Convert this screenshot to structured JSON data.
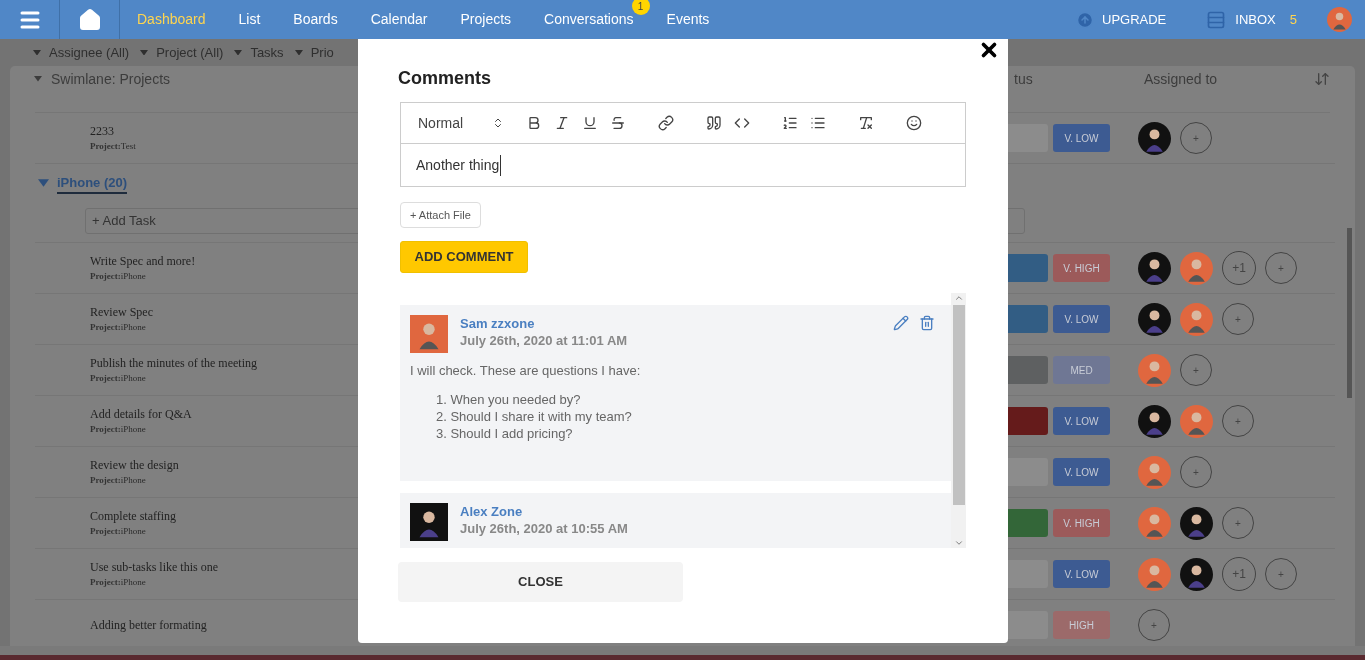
{
  "nav": {
    "items": [
      {
        "label": "Dashboard",
        "selected": true
      },
      {
        "label": "List",
        "selected": false
      },
      {
        "label": "Boards",
        "selected": false
      },
      {
        "label": "Calendar",
        "selected": false
      },
      {
        "label": "Projects",
        "selected": false
      },
      {
        "label": "Conversations",
        "selected": false,
        "badge": "1"
      },
      {
        "label": "Events",
        "selected": false
      }
    ],
    "upgrade": "UPGRADE",
    "inbox": "INBOX",
    "inbox_count": "5"
  },
  "filters": [
    "Assignee (All)",
    "Project (All)",
    "Tasks",
    "Prio"
  ],
  "swimlane": {
    "title": "Swimlane: Projects",
    "columns": [
      "tus",
      "Assigned to"
    ]
  },
  "rows_before": [
    {
      "name": "2233",
      "project_label": "Project:",
      "project": "Test",
      "status": {
        "color": "#8c8c8c"
      },
      "priority": {
        "label": "V. LOW",
        "color": "#3d5b92"
      },
      "assignees": [
        {
          "kind": "photo"
        }
      ],
      "add": "+"
    }
  ],
  "group": {
    "title": "iPhone (20)",
    "expanded": true,
    "add_task": "+ Add Task",
    "rows": [
      {
        "name": "Write Spec and more!",
        "project_label": "Project:",
        "project": "iPhone",
        "status": {
          "color": "#325d84"
        },
        "priority": {
          "label": "V. HIGH",
          "color": "#9c5a5a"
        },
        "assignees": [
          {
            "kind": "photo"
          },
          {
            "kind": "cartoon"
          }
        ],
        "extra": "+1",
        "add": "+"
      },
      {
        "name": "Review Spec",
        "project_label": "Project:",
        "project": "iPhone",
        "status": {
          "color": "#325d84"
        },
        "priority": {
          "label": "V. LOW",
          "color": "#3d5b92"
        },
        "assignees": [
          {
            "kind": "photo"
          },
          {
            "kind": "cartoon"
          }
        ],
        "add": "+"
      },
      {
        "name": "Publish the minutes of the meeting",
        "project_label": "Project:",
        "project": "iPhone",
        "status": {
          "color": "#5e6061"
        },
        "priority": {
          "label": "MED",
          "color": "#6f7794"
        },
        "assignees": [
          {
            "kind": "cartoon"
          }
        ],
        "add": "+"
      },
      {
        "name": "Add details for Q&A",
        "project_label": "Project:",
        "project": "iPhone",
        "status": {
          "color": "#651b1b"
        },
        "priority": {
          "label": "V. LOW",
          "color": "#3d5b92"
        },
        "assignees": [
          {
            "kind": "photo"
          },
          {
            "kind": "cartoon"
          }
        ],
        "add": "+"
      },
      {
        "name": "Review the design",
        "project_label": "Project:",
        "project": "iPhone",
        "status": {
          "color": "#8c8c8c"
        },
        "priority": {
          "label": "V. LOW",
          "color": "#3d5b92"
        },
        "assignees": [
          {
            "kind": "cartoon"
          }
        ],
        "add": "+"
      },
      {
        "name": "Complete staffing",
        "project_label": "Project:",
        "project": "iPhone",
        "status": {
          "color": "#336638"
        },
        "priority": {
          "label": "V. HIGH",
          "color": "#9c5a5a"
        },
        "assignees": [
          {
            "kind": "cartoon"
          },
          {
            "kind": "photo"
          }
        ],
        "add": "+"
      },
      {
        "name": "Use sub-tasks like this one",
        "project_label": "Project:",
        "project": "iPhone",
        "status": {
          "color": "#8c8c8c"
        },
        "priority": {
          "label": "V. LOW",
          "color": "#3d5b92"
        },
        "assignees": [
          {
            "kind": "cartoon"
          },
          {
            "kind": "photo"
          }
        ],
        "extra": "+1",
        "add": "+"
      },
      {
        "name": "Adding better formating",
        "status": {
          "color": "#8c8c8c"
        },
        "priority": {
          "label": "HIGH",
          "color": "#9c6a6a"
        },
        "assignees": [],
        "add": "+"
      }
    ]
  },
  "modal": {
    "title": "Comments",
    "editor": {
      "format": "Normal",
      "value": "Another thing"
    },
    "attach": "+ Attach File",
    "submit": "ADD COMMENT",
    "comments": [
      {
        "author": "Sam zzxone",
        "avatar": {
          "kind": "cartoon"
        },
        "date": "July 26th, 2020 at 11:01 AM",
        "editable": true,
        "text": "I will check. These are questions I have:",
        "list": [
          "1. When you needed by?",
          "2. Should I share it with my team?",
          "3. Should I add pricing?"
        ]
      },
      {
        "author": "Alex Zone",
        "avatar": {
          "kind": "photo"
        },
        "date": "July 26th, 2020 at 10:55 AM",
        "editable": false
      }
    ],
    "close_button": "CLOSE"
  }
}
